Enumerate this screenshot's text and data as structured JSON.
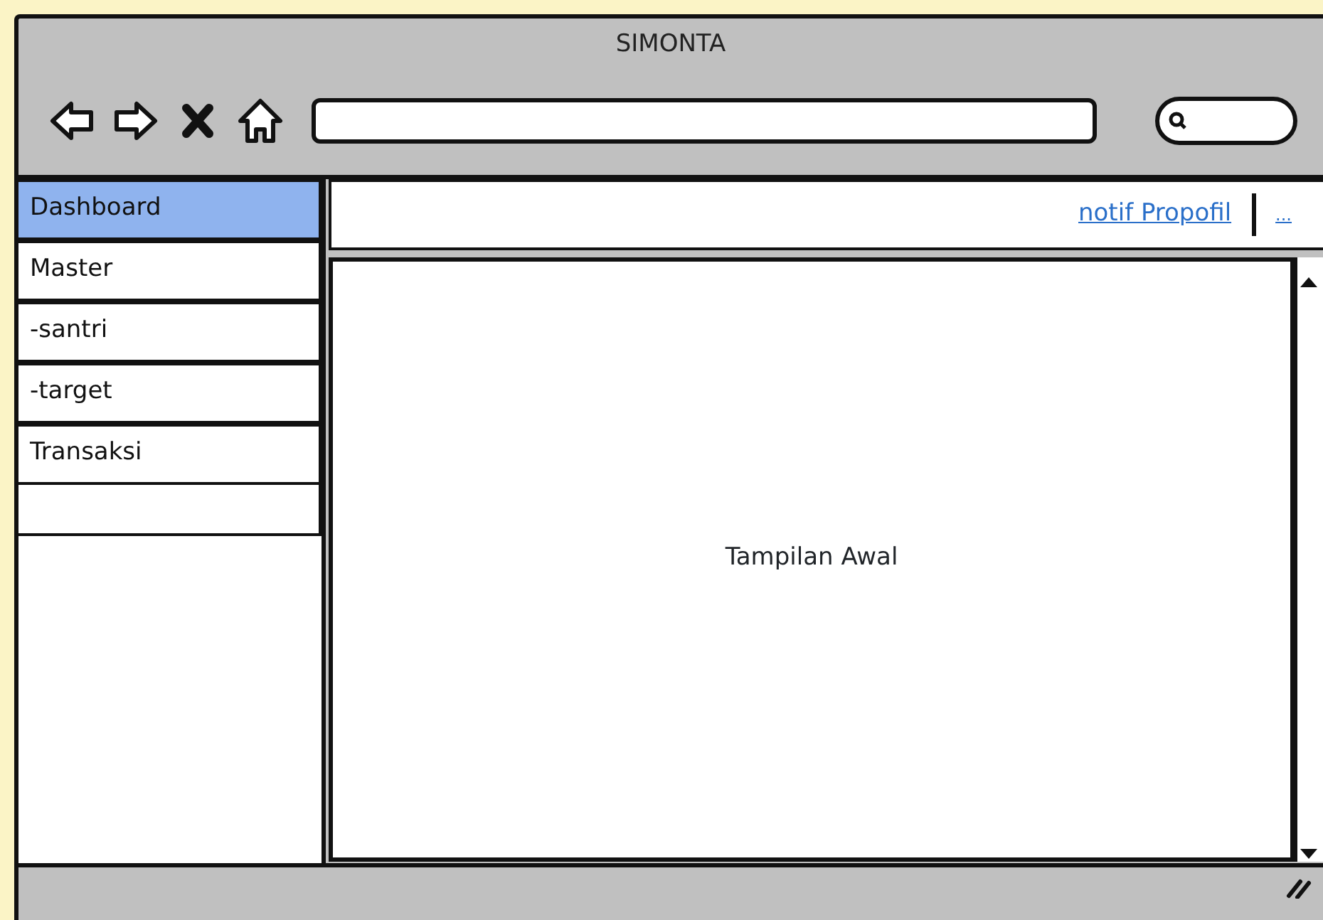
{
  "window": {
    "title": "SIMONTA"
  },
  "toolbar": {
    "buttons": [
      {
        "kind": "back"
      },
      {
        "kind": "forward"
      },
      {
        "kind": "stop"
      },
      {
        "kind": "home"
      }
    ]
  },
  "sidebar": {
    "items": [
      {
        "label": "Dashboard",
        "selected": true
      },
      {
        "label": "Master",
        "selected": false
      },
      {
        "label": "-santri",
        "selected": false
      },
      {
        "label": "-target",
        "selected": false
      },
      {
        "label": "Transaksi",
        "selected": false
      }
    ]
  },
  "header_links": [
    {
      "label": "notif Propofil"
    },
    {
      "label": "..."
    }
  ],
  "content": {
    "text": "Tampilan Awal"
  }
}
